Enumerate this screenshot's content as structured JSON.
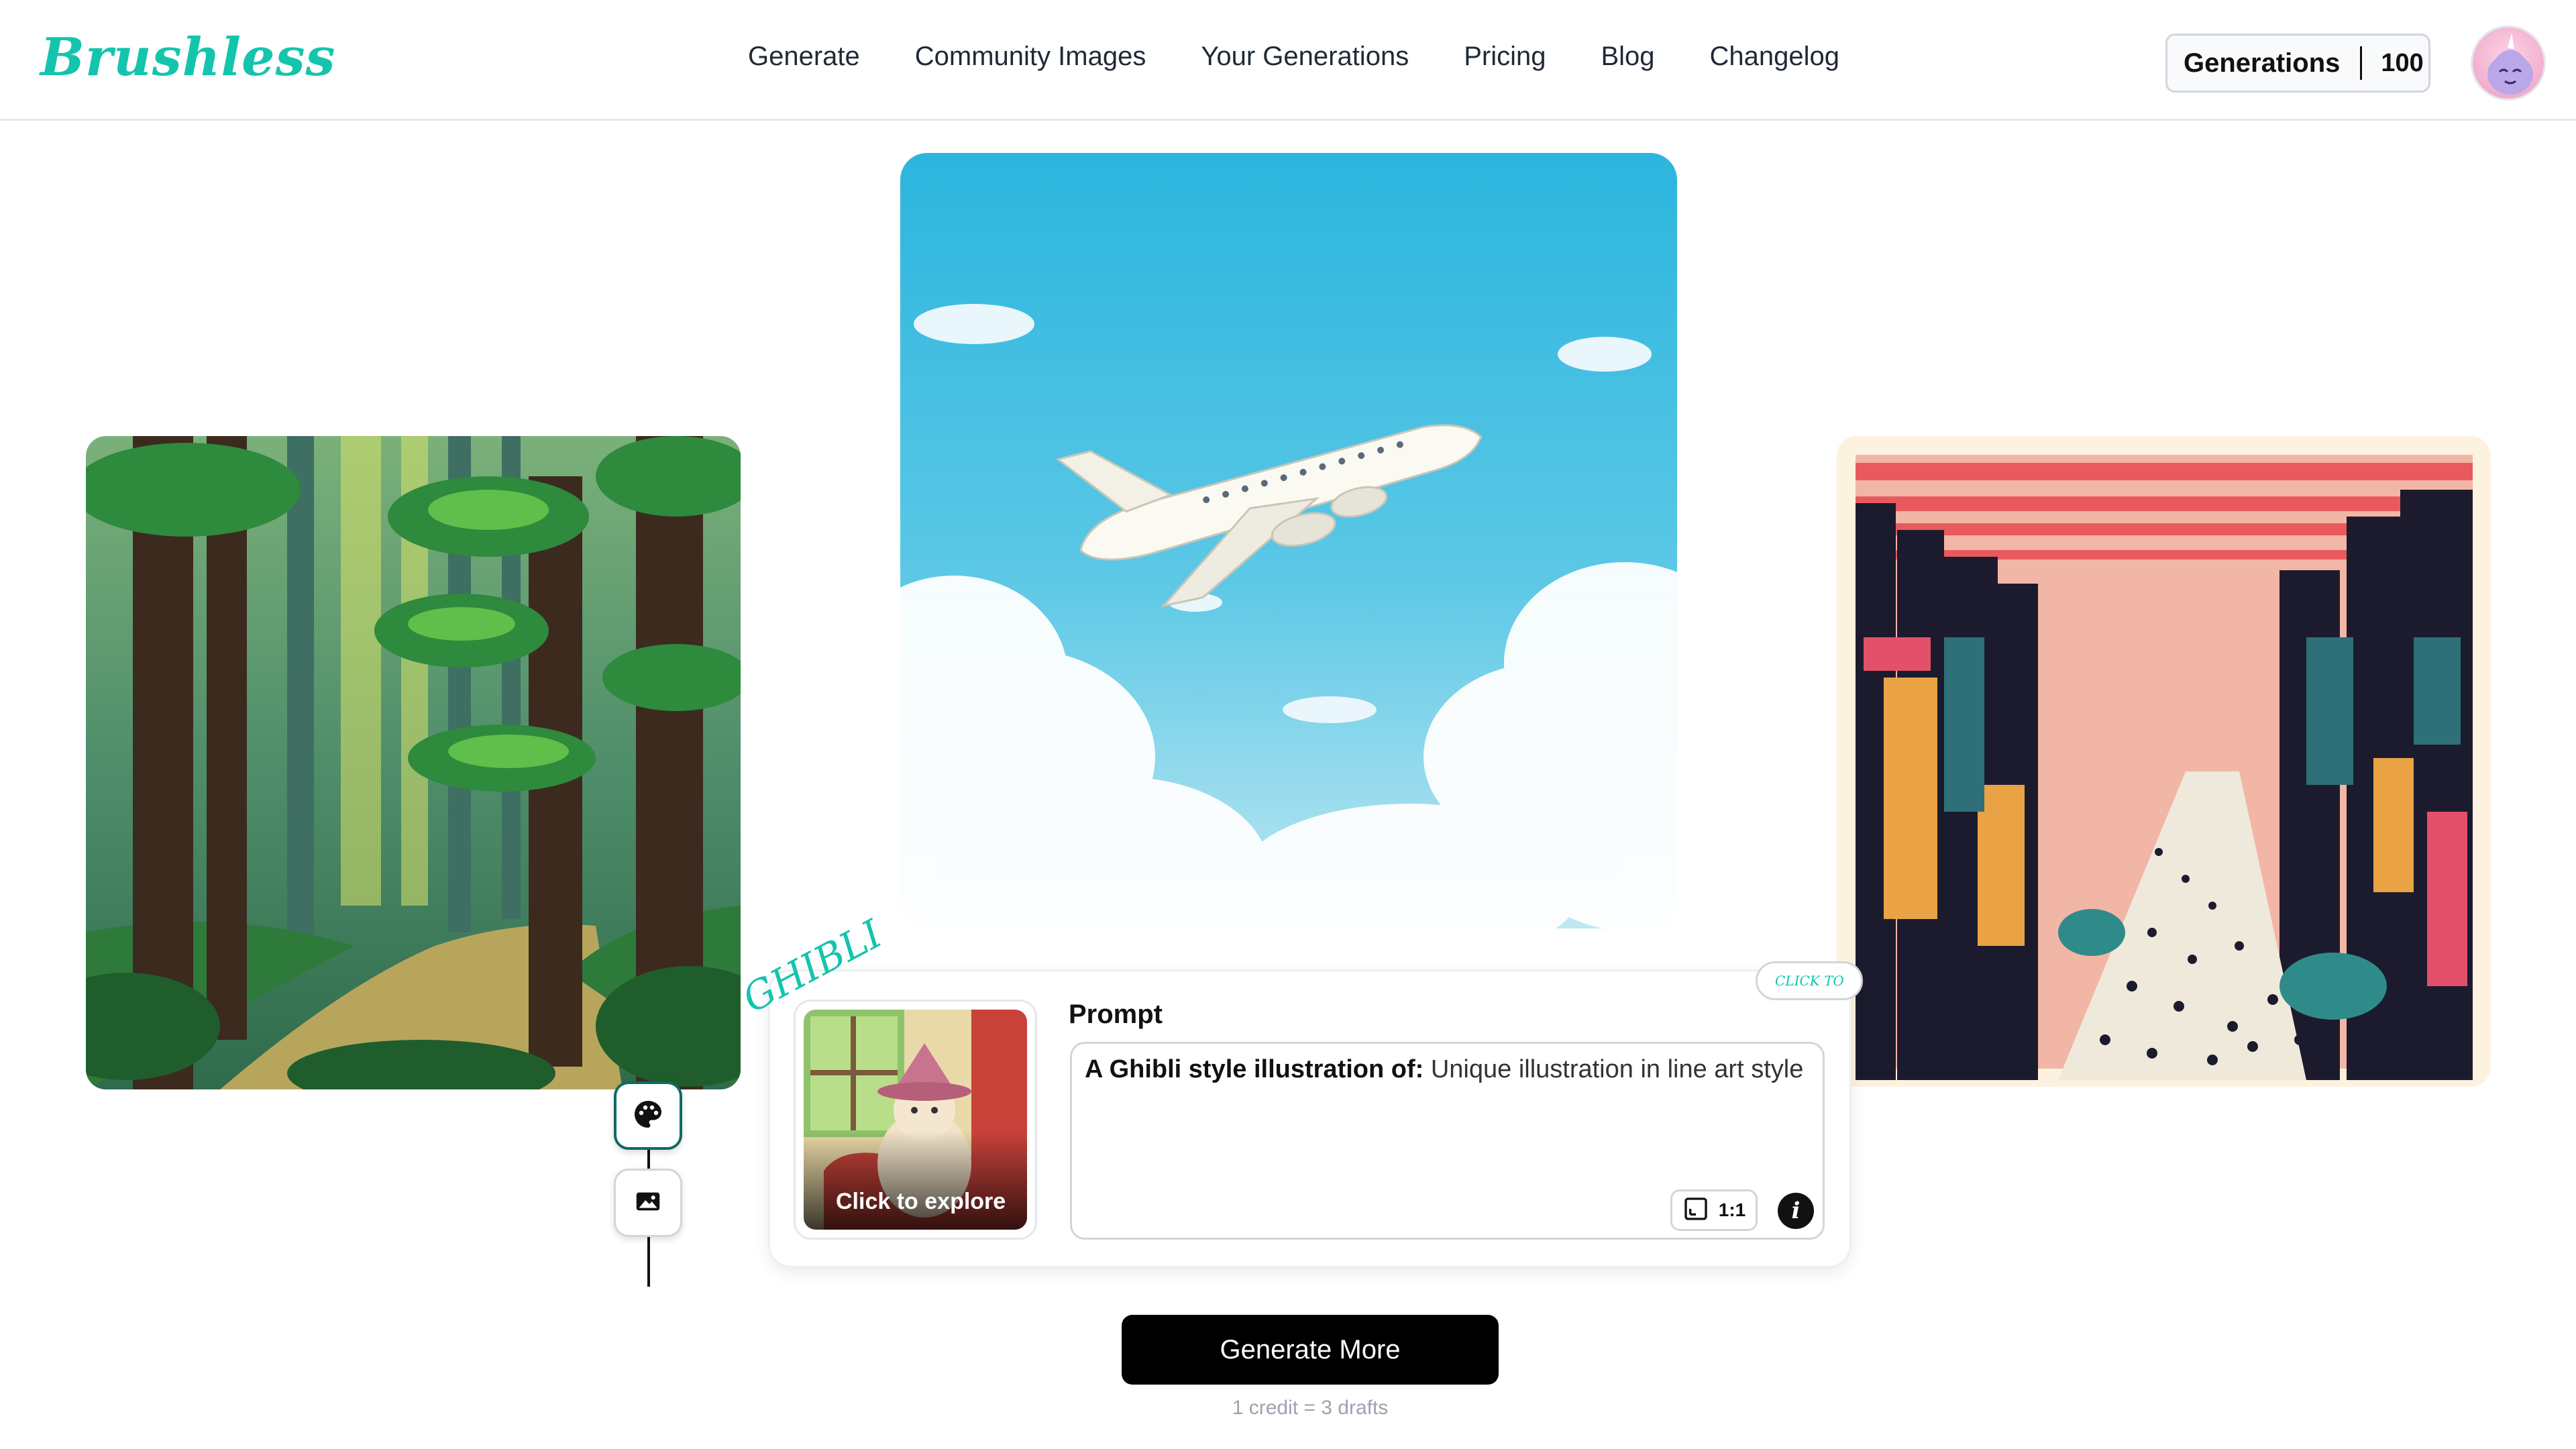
{
  "header": {
    "logo": "Brushless",
    "nav": [
      "Generate",
      "Community Images",
      "Your Generations",
      "Pricing",
      "Blog",
      "Changelog"
    ],
    "generations_label": "Generations",
    "generations_count": "100"
  },
  "style_tag": "GHIBLI",
  "click_pill": "CLICK TO",
  "thumbnail": {
    "caption": "Click to explore"
  },
  "prompt": {
    "label": "Prompt",
    "prefix": "A Ghibli style illustration of:",
    "text": "Unique illustration in line art style",
    "aspect_ratio": "1:1"
  },
  "generate_button": "Generate More",
  "credit_note": "1 credit = 3 drafts",
  "colors": {
    "accent": "#14c4ad",
    "button": "#000000"
  }
}
